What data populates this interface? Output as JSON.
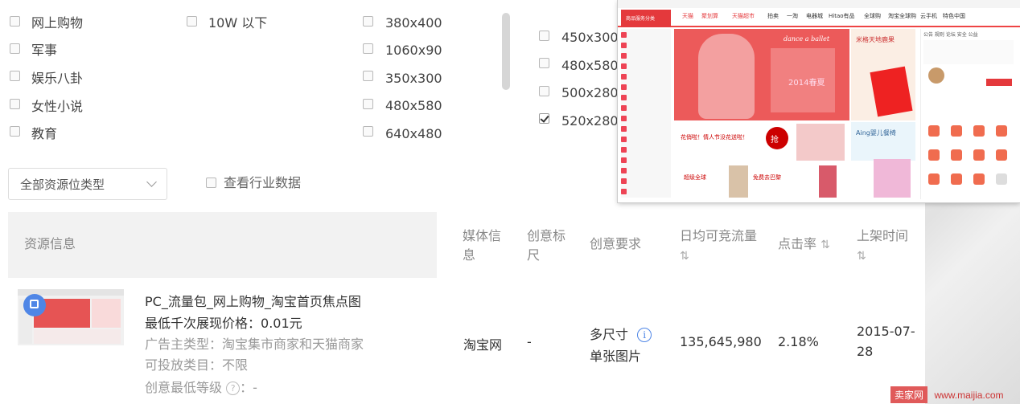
{
  "filters": {
    "industry_options": [
      {
        "label": "网上购物",
        "checked": false
      },
      {
        "label": "军事",
        "checked": false
      },
      {
        "label": "娱乐八卦",
        "checked": false
      },
      {
        "label": "女性小说",
        "checked": false
      },
      {
        "label": "教育",
        "checked": false
      }
    ],
    "traffic_options": [
      {
        "label": "10W 以下",
        "checked": false
      }
    ],
    "size_options_col1": [
      {
        "label": "380x400",
        "checked": false
      },
      {
        "label": "1060x90",
        "checked": false
      },
      {
        "label": "350x300",
        "checked": false
      },
      {
        "label": "480x580",
        "checked": false
      },
      {
        "label": "640x480",
        "checked": false
      }
    ],
    "size_options_col2": [
      {
        "label": "450x300",
        "checked": false
      },
      {
        "label": "480x580",
        "checked": false
      },
      {
        "label": "500x280",
        "checked": false
      },
      {
        "label": "520x280",
        "checked": true
      }
    ],
    "resource_type_select": "全部资源位类型",
    "industry_data_label": "查看行业数据",
    "industry_data_checked": false
  },
  "table": {
    "headers": {
      "resource_info": "资源信息",
      "media_info": "媒体信息",
      "creative_label": "创意标尺",
      "creative_req": "创意要求",
      "daily_traffic": "日均可竞流量",
      "ctr": "点击率",
      "listing_time": "上架时间",
      "sort_symbol": "⇅"
    },
    "rows": [
      {
        "title": "PC_流量包_网上购物_淘宝首页焦点图",
        "min_price_label": "最低千次展现价格：",
        "min_price": "0.01元",
        "advertiser_type": "广告主类型：淘宝集市商家和天猫商家",
        "allowed_category": "可投放类目：不限",
        "min_creative_level_label": "创意最低等级",
        "min_creative_level_value": "：-",
        "media": "淘宝网",
        "creative_label": "-",
        "creative_req_line1": "多尺寸",
        "creative_req_line2": "单张图片",
        "daily_traffic": "135,645,980",
        "ctr": "2.18%",
        "listing_time_line1": "2015-07-",
        "listing_time_line2": "28"
      }
    ]
  },
  "preview": {
    "nav_category": "商品服务分类",
    "nav_items": [
      "天猫",
      "聚划算",
      "天猫超市",
      "拍卖",
      "一淘",
      "电器城",
      "Hitao有品",
      "全球购",
      "淘宝全球购",
      "云手机",
      "特色中国"
    ],
    "hero_title": "dance a ballet",
    "hero_sub": "2014春夏",
    "side_ad": "米格天地鹿果",
    "row2_ad": "花俏啦！情人节没花送啦！",
    "row2_badge": "抢",
    "row2b_ad": "Aing婴儿餐椅",
    "row3_left": "超级全球",
    "row3_mid": "免费去巴黎",
    "right_tabs": "公告  规则  论坛  安全  公益",
    "colors": {
      "brand": "#e4393c",
      "hero": "#ec5a5a"
    }
  },
  "watermark": {
    "brand": "卖家网",
    "url": "www.maijia.com"
  }
}
